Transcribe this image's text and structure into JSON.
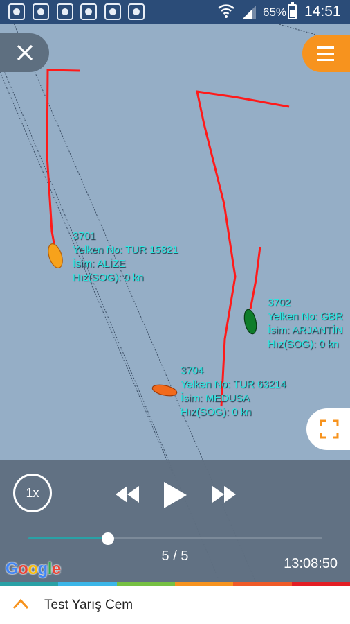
{
  "status_bar": {
    "notification_icons": [
      "app-notification-icon",
      "app-notification-icon",
      "app-notification-icon",
      "app-notification-icon",
      "app-notification-icon",
      "app-notification-icon"
    ],
    "battery_percent": "65%",
    "clock": "14:51"
  },
  "map": {
    "boats": [
      {
        "id": "3701",
        "sail_line": "Yelken No: TUR 15821",
        "name_line": "İsim: ALİZE",
        "speed_line": "Hız(SOG): 0 kn",
        "color": "#f7a21b"
      },
      {
        "id": "3702",
        "sail_line": "Yelken No: GBR",
        "name_line": "İsim: ARJANTİN",
        "speed_line": "Hız(SOG): 0 kn",
        "color": "#0e7d2a"
      },
      {
        "id": "3704",
        "sail_line": "Yelken No: TUR 63214",
        "name_line": "İsim: MEDUSA",
        "speed_line": "Hız(SOG): 0 kn",
        "color": "#f26a1b"
      }
    ],
    "track_color": "#ff1a1a"
  },
  "player": {
    "speed": "1x",
    "progress_fraction": 0.27,
    "step": "5 / 5",
    "time": "13:08:50"
  },
  "google_logo": {
    "letters": [
      "G",
      "o",
      "o",
      "g",
      "l",
      "e"
    ]
  },
  "colors": {
    "accent": "#f7931e",
    "strip": [
      "#2aa1a6",
      "#3bb6e8",
      "#76c043",
      "#f7931e",
      "#ef5a28",
      "#e31e24"
    ]
  },
  "bottom_bar": {
    "title": "Test Yarış Cem"
  }
}
